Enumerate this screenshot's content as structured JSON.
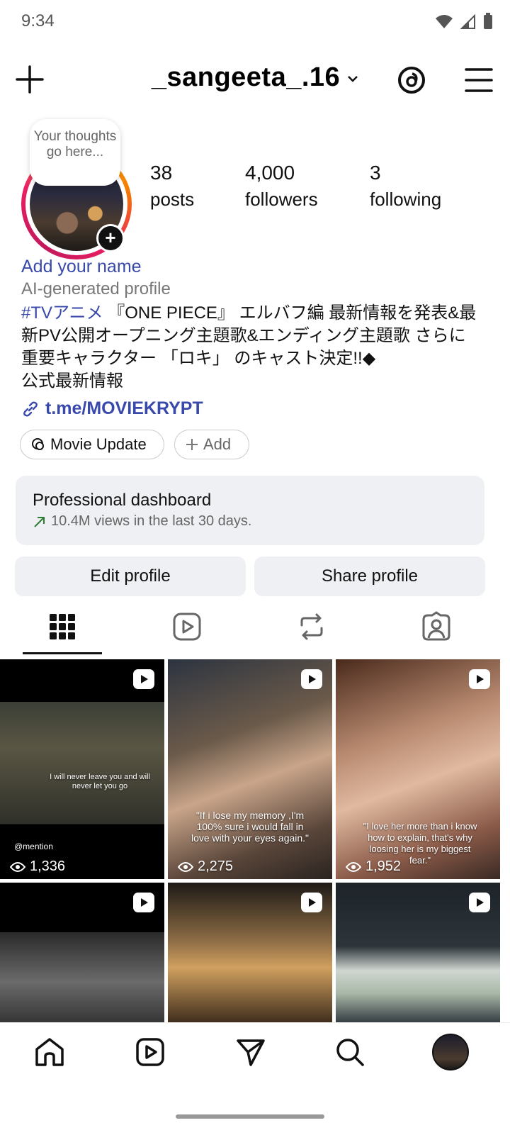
{
  "status_bar": {
    "time": "9:34"
  },
  "header": {
    "username": "_sangeeta_.16"
  },
  "note": {
    "text": "Your thoughts go here..."
  },
  "stats": [
    {
      "value": "38",
      "label": "posts"
    },
    {
      "value": "4,000",
      "label": "followers"
    },
    {
      "value": "3",
      "label": "following"
    }
  ],
  "profile": {
    "add_name": "Add your name",
    "ai_label": "AI-generated profile",
    "bio_hashtag": "#TVアニメ",
    "bio_line1": " 『ONE PIECE』 エルバフ編 最新情報を発表&最",
    "bio_line2": "新PV公開オープニング主題歌&エンディング主題歌 さらに",
    "bio_line3": "重要キャラクター 「ロキ」 のキャスト決定!!◆",
    "bio_line4": "公式最新情報",
    "link": "t.me/MOVIEKRYPT"
  },
  "highlights": [
    {
      "label": "Movie Update"
    },
    {
      "label": "Add"
    }
  ],
  "dashboard": {
    "title": "Professional dashboard",
    "subtitle": "10.4M views in the last 30 days."
  },
  "buttons": {
    "edit": "Edit profile",
    "share": "Share profile"
  },
  "posts": [
    {
      "views": "1,336",
      "caption": "I will never leave you and will never let you go",
      "tag": "@mention"
    },
    {
      "views": "2,275",
      "caption": "\"If i lose my memory ,I'm 100% sure i would fall in love with your eyes again.\""
    },
    {
      "views": "1,952",
      "caption": "\"I love her more than i know how to explain, that's why loosing her is my biggest fear.\""
    },
    {
      "views": ""
    },
    {
      "views": ""
    },
    {
      "views": ""
    }
  ],
  "colors": {
    "link_blue": "#3949ab",
    "growth_green": "#2e7d32",
    "surface_gray": "#eff0f3"
  }
}
